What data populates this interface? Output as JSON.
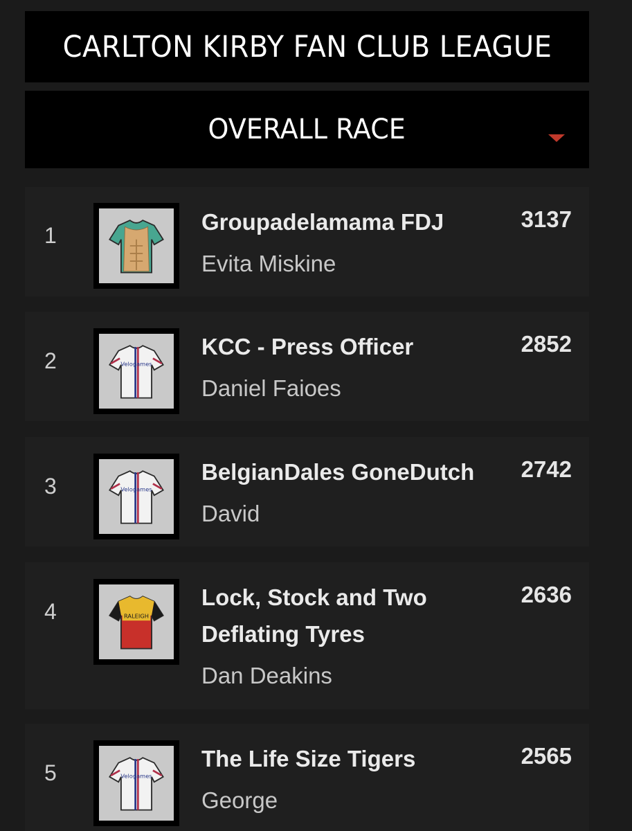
{
  "league": {
    "title": "CARLTON KIRBY FAN CLUB LEAGUE"
  },
  "race_selector": {
    "selected": "OVERALL RACE",
    "caret_icon": "caret-down-icon",
    "accent": "#c0392b"
  },
  "rows": [
    {
      "rank": "1",
      "team": "Groupadelamama FDJ",
      "manager": "Evita Miskine",
      "points": "3137",
      "jersey": "sixpack-jersey"
    },
    {
      "rank": "2",
      "team": "KCC - Press Officer",
      "manager": "Daniel Faioes",
      "points": "2852",
      "jersey": "velogames-jersey"
    },
    {
      "rank": "3",
      "team": "BelgianDales GoneDutch",
      "manager": "David",
      "points": "2742",
      "jersey": "velogames-jersey"
    },
    {
      "rank": "4",
      "team": "Lock, Stock and Two Deflating Tyres",
      "manager": "Dan Deakins",
      "points": "2636",
      "jersey": "raleigh-jersey"
    },
    {
      "rank": "5",
      "team": "The Life Size Tigers",
      "manager": "George",
      "points": "2565",
      "jersey": "velogames-jersey"
    }
  ]
}
